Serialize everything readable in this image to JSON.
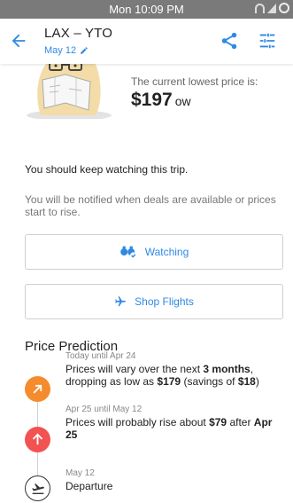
{
  "status_bar": {
    "time": "Mon 10:09 PM"
  },
  "header": {
    "route": "LAX – YTO",
    "date": "May 12"
  },
  "price_summary": {
    "label": "The current lowest price is:",
    "amount": "$197",
    "unit": "ow"
  },
  "advice": {
    "headline": "You should keep watching this trip.",
    "detail": "You will be notified when deals are available or prices start to rise."
  },
  "buttons": {
    "watching": "Watching",
    "shop_flights": "Shop Flights"
  },
  "prediction": {
    "title": "Price Prediction",
    "events": [
      {
        "when": "Today until Apr 24",
        "desc_parts": [
          "Prices will vary over the next ",
          "3 months",
          ", dropping as low as ",
          "$179",
          " (savings of ",
          "$18",
          ")"
        ],
        "icon": "arrow-down-right-icon",
        "color": "#f58b2d"
      },
      {
        "when": "Apr 25 until May 12",
        "desc_parts": [
          "Prices will probably rise about ",
          "$79",
          " after ",
          "Apr 25"
        ],
        "icon": "arrow-up-icon",
        "color": "#f25252"
      },
      {
        "when": "May 12",
        "desc": "Departure",
        "icon": "airplane-takeoff-icon",
        "color": "#ffffff"
      }
    ]
  },
  "colors": {
    "accent": "#2f89e4",
    "status_bar": "#7a7a7a"
  }
}
